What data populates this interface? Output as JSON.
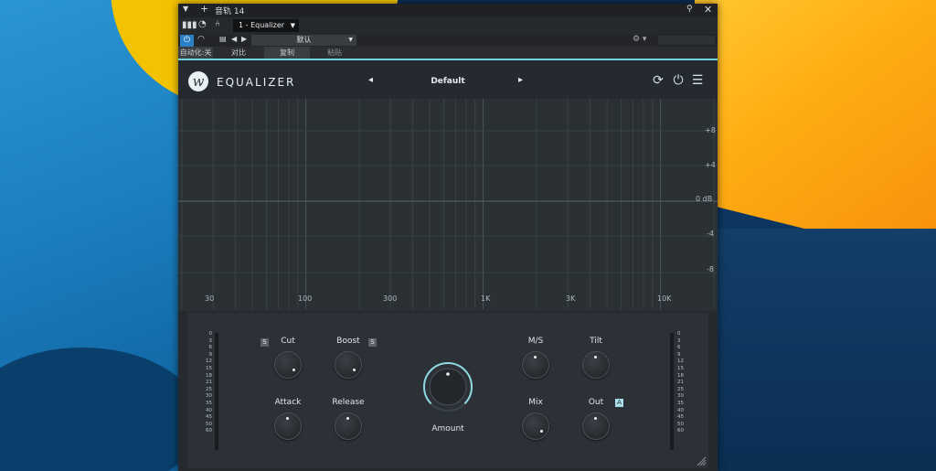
{
  "colors": {
    "accent": "#6fd3de",
    "panel": "#262a2f",
    "knob_dot": "#eef3f5"
  },
  "host": {
    "title": "音轨 14",
    "track_select": "1 - Equalizer",
    "preset": "默认",
    "tabs": [
      "自动化:关",
      "对比",
      "复制",
      "粘贴"
    ]
  },
  "plugin": {
    "title": "EQUALIZER",
    "preset_name": "Default",
    "icons": [
      "refresh-icon",
      "power-icon",
      "menu-icon"
    ]
  },
  "graph": {
    "db_labels": [
      "+8",
      "+4",
      "0 dB",
      "-4",
      "-8"
    ],
    "hz_labels": [
      "30",
      "100",
      "300",
      "1K",
      "3K",
      "10K"
    ]
  },
  "meter_scale": [
    "0",
    "3",
    "6",
    "9",
    "12",
    "15",
    "18",
    "21",
    "25",
    "30",
    "35",
    "40",
    "45",
    "50",
    "60"
  ],
  "controls": {
    "cut": {
      "label": "Cut",
      "tag": "S"
    },
    "boost": {
      "label": "Boost",
      "tag": "S"
    },
    "attack": {
      "label": "Attack"
    },
    "release": {
      "label": "Release"
    },
    "amount": {
      "label": "Amount"
    },
    "ms": {
      "label": "M/S"
    },
    "tilt": {
      "label": "Tilt"
    },
    "mix": {
      "label": "Mix"
    },
    "out": {
      "label": "Out",
      "tag": "A"
    }
  }
}
